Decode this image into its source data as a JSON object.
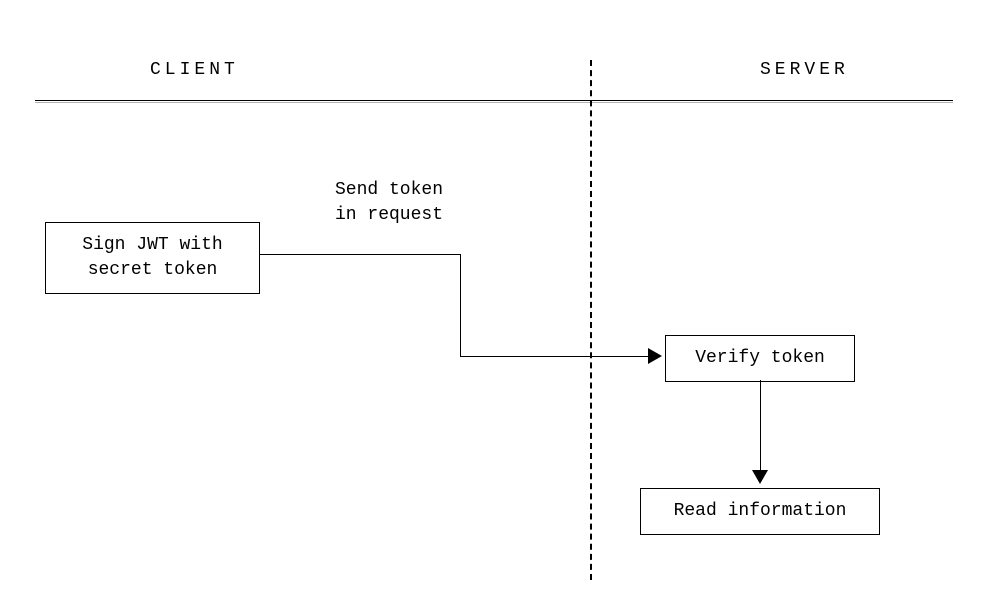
{
  "header": {
    "client": "CLIENT",
    "server": "SERVER"
  },
  "nodes": {
    "sign": "Sign JWT with\nsecret token",
    "verify": "Verify token",
    "read": "Read information"
  },
  "labels": {
    "send": "Send token\nin request"
  }
}
